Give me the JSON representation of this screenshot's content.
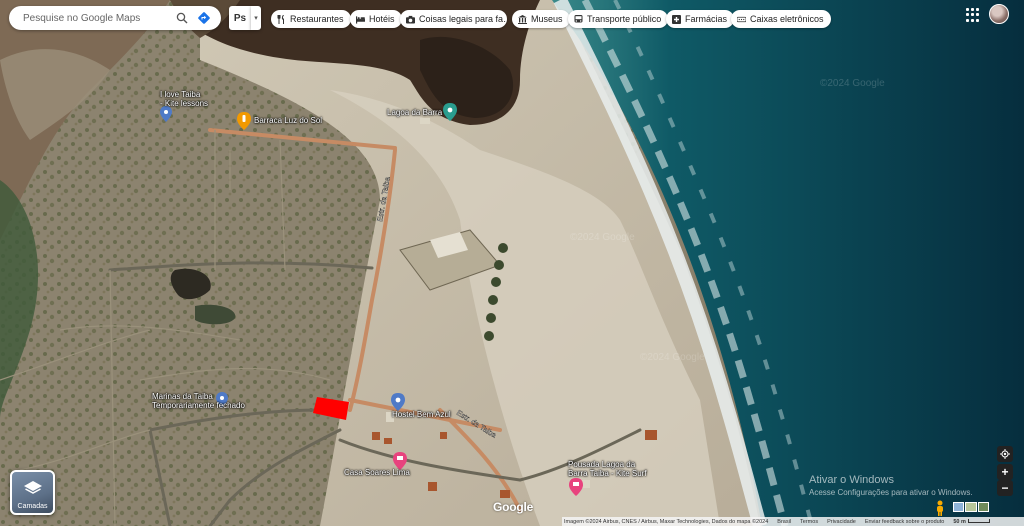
{
  "search": {
    "placeholder": "Pesquise no Google Maps"
  },
  "toolbar": {
    "ps_label": "Ps"
  },
  "chips": [
    {
      "label": "Restaurantes",
      "icon": "fork-knife-icon"
    },
    {
      "label": "Hotéis",
      "icon": "bed-icon"
    },
    {
      "label": "Coisas legais para fa…",
      "icon": "camera-icon"
    },
    {
      "label": "Museus",
      "icon": "museum-icon"
    },
    {
      "label": "Transporte público",
      "icon": "bus-icon"
    },
    {
      "label": "Farmácias",
      "icon": "pharmacy-icon"
    },
    {
      "label": "Caixas eletrônicos",
      "icon": "atm-icon"
    }
  ],
  "places": {
    "ilove_taiba": {
      "line1": "I love Taiba",
      "line2": "- Kite lessons"
    },
    "barraca": "Barraca Luz do Sol",
    "lagoa": "Lagoa da Barra",
    "marinas": {
      "line1": "Marinas da Taiba",
      "line2": "Temporariamente fechado"
    },
    "bem_azul": "Hostel Bem Azul",
    "casa_soares": "Casa Soares Lima",
    "pousada": {
      "line1": "Pousada Lagoa da",
      "line2": "Barra Taiba - Kite Surf"
    }
  },
  "roads": {
    "estrada_taiba_1": "Estr. da Taiba",
    "estrada_taiba_2": "Estr. da Taiba"
  },
  "watermarks": [
    "©2024 Google",
    "©2024 Google",
    "©2024 Google"
  ],
  "layers": {
    "label": "Camadas"
  },
  "brand": {
    "logo": "Google"
  },
  "activate": {
    "title": "Ativar o Windows",
    "subtitle": "Acesse Configurações para ativar o Windows."
  },
  "attribution": {
    "imagery": "Imagem ©2024 Airbus, CNES / Airbus, Maxar Technologies, Dados do mapa ©2024",
    "brazil": "Brasil",
    "terms": "Termos",
    "privacy": "Privacidade",
    "feedback": "Enviar feedback sobre o produto",
    "scale": "50 m"
  },
  "colors": {
    "accent": "#1a73e8",
    "highlight": "#ff0000",
    "poi_red": "#ea4335",
    "poi_orange": "#f29900",
    "poi_blue": "#4f7ac7",
    "poi_pink": "#e8437e"
  }
}
